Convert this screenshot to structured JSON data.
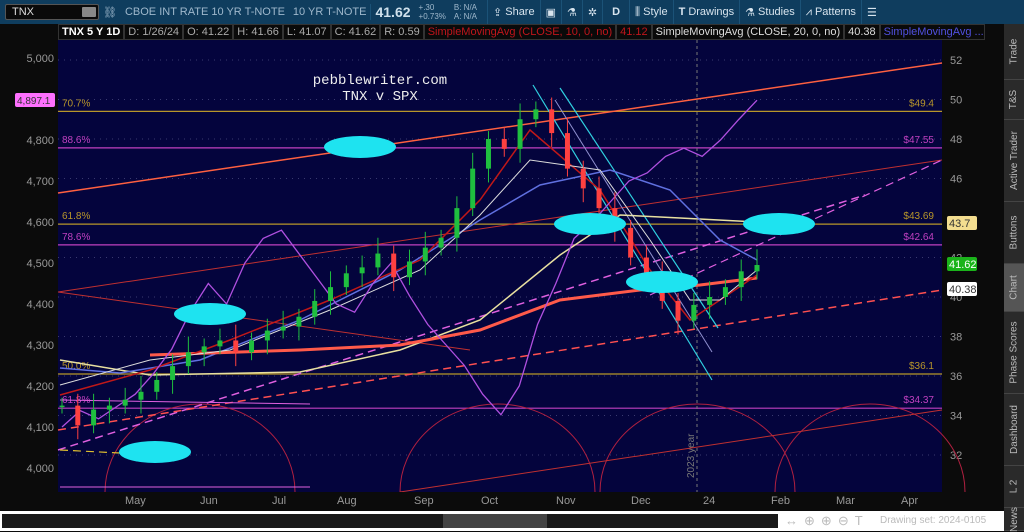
{
  "toolbar": {
    "symbol": "TNX",
    "description": "CBOE INT RATE 10 YR T-NOTE",
    "short_desc": "10 YR T-NOTE",
    "last": "41.62",
    "change": "+.30",
    "change_pct": "+0.73%",
    "bid": "B: N/A",
    "ask": "A: N/A",
    "share": "Share",
    "aggregation": "D",
    "style": "Style",
    "drawings": "Drawings",
    "studies": "Studies",
    "patterns": "Patterns"
  },
  "header": {
    "title": "TNX 5 Y 1D",
    "date": "D: 1/26/24",
    "open": "O: 41.22",
    "high": "H: 41.66",
    "low": "L: 41.07",
    "close": "C: 41.62",
    "range": "R: 0.59",
    "sma10": "SimpleMovingAvg (CLOSE, 10, 0, no)",
    "sma10_val": "41.12",
    "sma20": "SimpleMovingAvg (CLOSE, 20, 0, no)",
    "sma20_val": "40.38",
    "sma3": "SimpleMovingAvg ..."
  },
  "annotation": {
    "line1": "pebblewriter.com",
    "line2": "TNX v SPX",
    "year": "2023 year"
  },
  "chart_data": {
    "type": "line",
    "title": "TNX v SPX",
    "right_axis": {
      "ticks": [
        "52",
        "50",
        "48",
        "46",
        "42",
        "40",
        "38",
        "36",
        "34",
        "32"
      ],
      "range": [
        30,
        53
      ]
    },
    "left_axis": {
      "ticks": [
        "5,000",
        "4,800",
        "4,700",
        "4,600",
        "4,500",
        "4,400",
        "4,300",
        "4,200",
        "4,100",
        "4,000"
      ],
      "range": [
        3930,
        5050
      ]
    },
    "x_ticks": [
      "May",
      "Jun",
      "Jul",
      "Aug",
      "Sep",
      "Oct",
      "Nov",
      "Dec",
      "24",
      "Feb",
      "Mar",
      "Apr"
    ],
    "tnx_close": [
      34.5,
      33.5,
      34.3,
      34.5,
      34.8,
      35.2,
      35.8,
      36.5,
      37.2,
      37.5,
      37.8,
      37.2,
      37.8,
      38.3,
      38.5,
      39.0,
      39.8,
      40.5,
      41.2,
      41.5,
      42.2,
      41.0,
      41.8,
      42.5,
      43.0,
      44.5,
      46.5,
      48.0,
      47.5,
      49.0,
      49.5,
      48.3,
      46.5,
      45.5,
      44.5,
      43.5,
      42.0,
      41.0,
      39.8,
      38.8,
      39.6,
      40.0,
      40.5,
      41.3,
      41.62
    ],
    "spx": [
      4100,
      4140,
      4120,
      4150,
      4180,
      4230,
      4290,
      4380,
      4450,
      4400,
      4500,
      4560,
      4580,
      4520,
      4460,
      4400,
      4380,
      4450,
      4500,
      4420,
      4350,
      4300,
      4250,
      4180,
      4130,
      4200,
      4350,
      4450,
      4560,
      4600,
      4650,
      4700,
      4720,
      4760,
      4780,
      4760,
      4800,
      4850,
      4897.1
    ],
    "levels": [
      {
        "label": "70.7%",
        "value": "$49.4",
        "price": 49.4,
        "color": "#b8962a"
      },
      {
        "label": "88.6%",
        "value": "$47.55",
        "price": 47.55,
        "color": "#c040c0"
      },
      {
        "label": "61.8%",
        "value": "$43.69",
        "price": 43.69,
        "color": "#b8962a"
      },
      {
        "label": "78.6%",
        "value": "$42.64",
        "price": 42.64,
        "color": "#c040c0"
      },
      {
        "label": "50.0%",
        "value": "$36.1",
        "price": 36.1,
        "color": "#b8962a"
      },
      {
        "label": "61.8%",
        "value": "$34.37",
        "price": 34.37,
        "color": "#c040c0"
      }
    ],
    "price_tags": [
      {
        "text": "43.7",
        "bg": "#f3dd8f",
        "fg": "#333"
      },
      {
        "text": "41.62",
        "bg": "#1bb31b",
        "fg": "#fff"
      },
      {
        "text": "40.38",
        "bg": "#ffffff",
        "fg": "#333"
      }
    ],
    "spx_tag": "4,897.1"
  },
  "sidebar": [
    "Trade",
    "T&S",
    "Active Trader",
    "Buttons",
    "Chart",
    "Phase Scores",
    "Dashboard",
    "L 2",
    "News"
  ],
  "footer": {
    "drawing_set": "Drawing set: 2024-0105"
  }
}
